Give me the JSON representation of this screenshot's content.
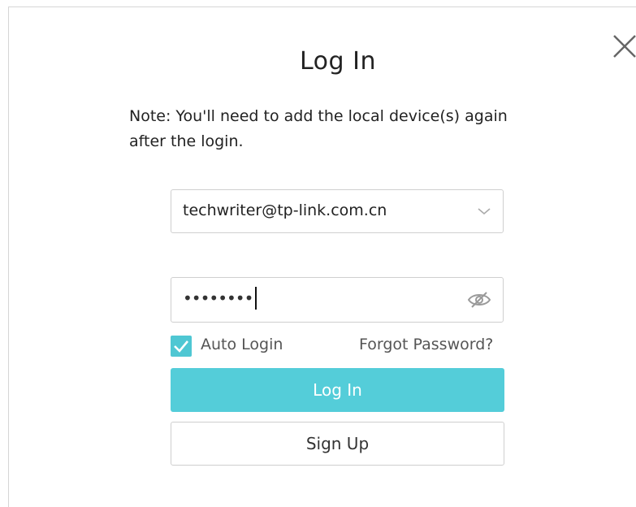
{
  "dialog": {
    "title": "Log In",
    "note": "Note:  You'll need to add the local device(s) again after the login.",
    "close_icon": "close-icon"
  },
  "email": {
    "value": "techwriter@tp-link.com.cn",
    "dropdown_icon": "chevron-down-icon"
  },
  "password": {
    "masked_value": "••••••••",
    "visibility_icon": "eye-slash-icon"
  },
  "options": {
    "auto_login_label": "Auto Login",
    "auto_login_checked": true,
    "forgot_password_label": "Forgot Password?"
  },
  "buttons": {
    "login_label": "Log In",
    "signup_label": "Sign Up"
  },
  "colors": {
    "accent": "#54cdd9",
    "checkbox": "#4fc7d3",
    "text": "#222222",
    "muted_text": "#555555",
    "border": "#cfcfcf"
  }
}
